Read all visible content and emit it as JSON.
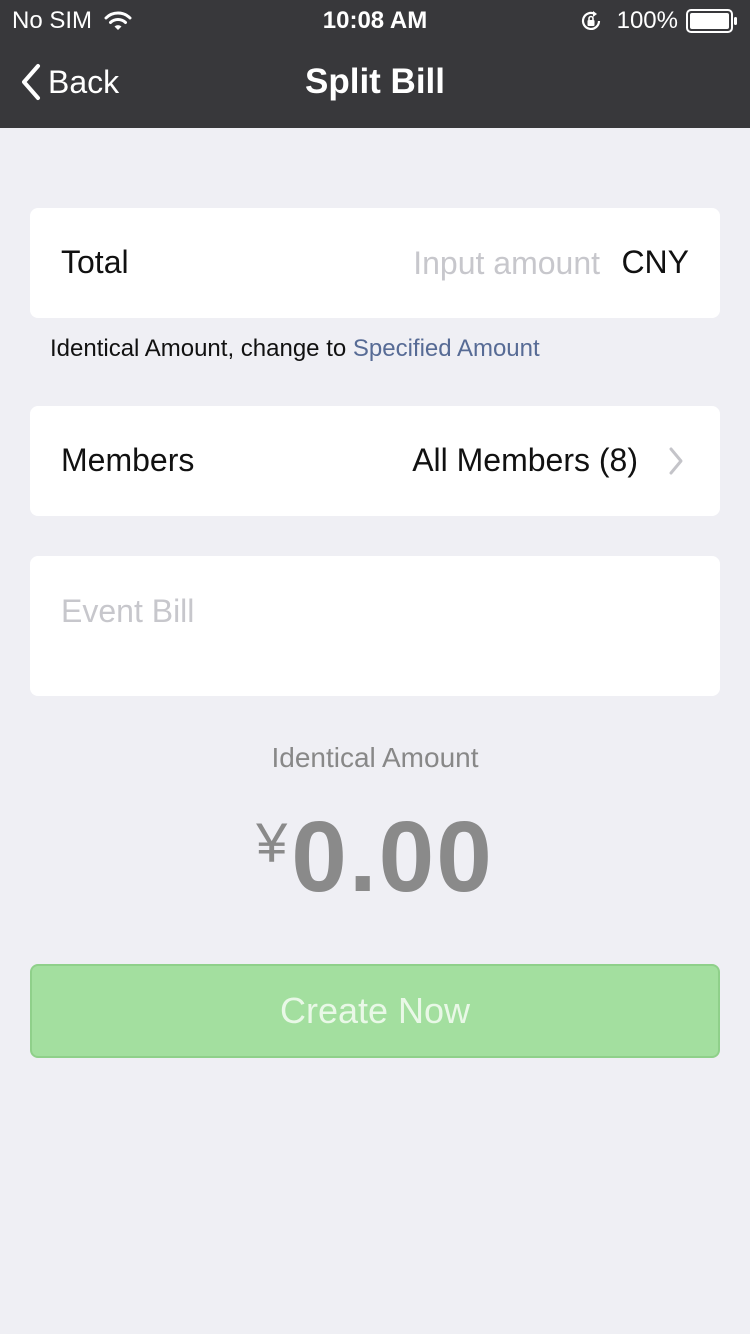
{
  "status_bar": {
    "carrier": "No SIM",
    "time": "10:08 AM",
    "battery": "100%"
  },
  "nav": {
    "back_label": "Back",
    "title": "Split Bill"
  },
  "total": {
    "label": "Total",
    "placeholder": "Input amount",
    "currency": "CNY"
  },
  "mode": {
    "current": "Identical Amount, change to ",
    "link": "Specified Amount"
  },
  "members": {
    "label": "Members",
    "value": "All Members (8)"
  },
  "event": {
    "placeholder": "Event Bill"
  },
  "summary": {
    "label": "Identical Amount",
    "symbol": "¥",
    "value": "0.00"
  },
  "actions": {
    "create_label": "Create Now"
  },
  "colors": {
    "nav_bg": "#38383b",
    "page_bg": "#efeff4",
    "link": "#576b95",
    "button_bg": "#a3df9f"
  },
  "icons": [
    "wifi-icon",
    "rotation-lock-icon",
    "battery-icon",
    "back-chevron-icon",
    "chevron-right-icon"
  ]
}
